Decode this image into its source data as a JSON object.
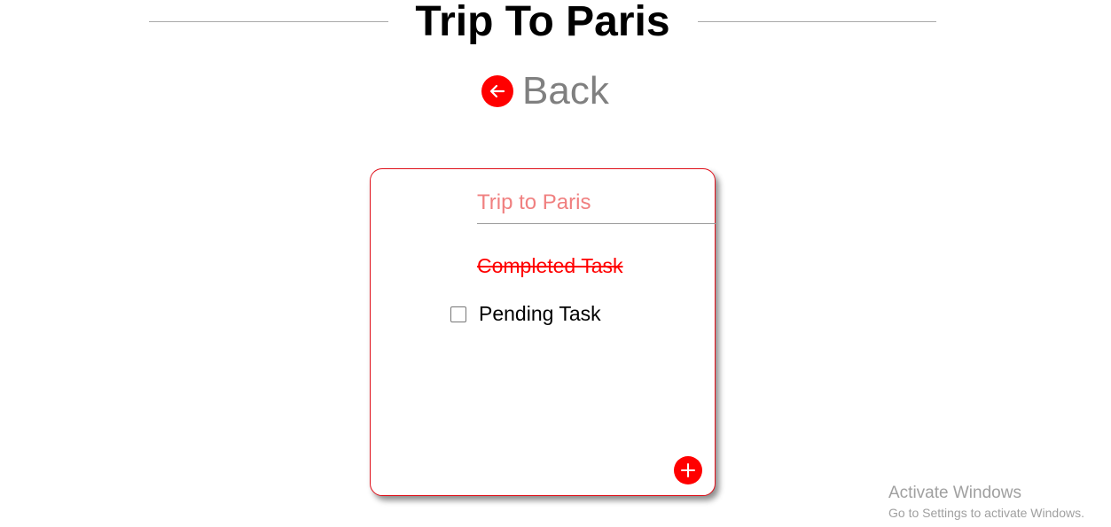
{
  "header": {
    "title": "Trip To Paris"
  },
  "back": {
    "label": "Back",
    "icon": "arrow-left-icon"
  },
  "card": {
    "title_value": "Trip to Paris",
    "tasks": [
      {
        "label": "Completed Task",
        "completed": true
      },
      {
        "label": "Pending Task",
        "completed": false
      }
    ],
    "add_icon": "plus-icon"
  },
  "watermark": {
    "title": "Activate Windows",
    "subtitle": "Go to Settings to activate Windows."
  },
  "colors": {
    "accent": "#ff0000",
    "title_input_text": "#f08080",
    "back_text": "#808080"
  }
}
